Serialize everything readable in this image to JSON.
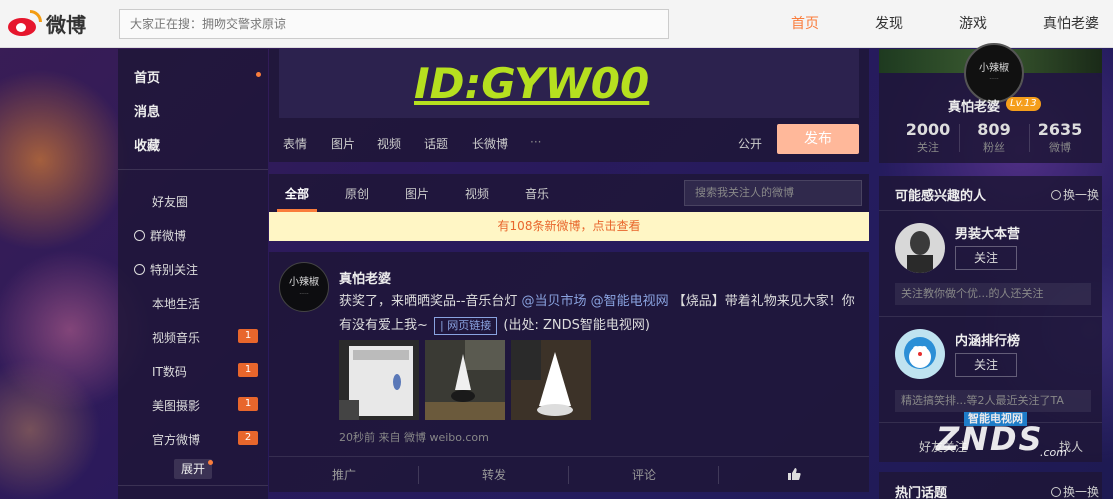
{
  "topbar": {
    "logo_text": "微博",
    "search_placeholder": "大家正在搜：拥吻交警求原谅",
    "nav": [
      "首页",
      "发现",
      "游戏",
      "真怕老婆"
    ]
  },
  "leftmenu": {
    "main": [
      "首页",
      "消息",
      "收藏"
    ],
    "groups": [
      {
        "label": "好友圈",
        "icon": "",
        "badge": ""
      },
      {
        "label": "群微博",
        "icon": "group-icon",
        "badge": ""
      },
      {
        "label": "特别关注",
        "icon": "star-icon",
        "badge": ""
      },
      {
        "label": "本地生活",
        "icon": "",
        "badge": ""
      },
      {
        "label": "视频音乐",
        "icon": "",
        "badge": "1"
      },
      {
        "label": "IT数码",
        "icon": "",
        "badge": "1"
      },
      {
        "label": "美图摄影",
        "icon": "",
        "badge": "1"
      },
      {
        "label": "官方微博",
        "icon": "",
        "badge": "2"
      }
    ],
    "expand": "展开"
  },
  "composer": {
    "content": "ID:GYW00",
    "tools": [
      "表情",
      "图片",
      "视频",
      "话题",
      "长微博",
      "···"
    ],
    "visibility": "公开",
    "publish": "发布"
  },
  "feed": {
    "tabs": [
      "全部",
      "原创",
      "图片",
      "视频",
      "音乐"
    ],
    "search_placeholder": "搜索我关注人的微博",
    "new_notice": "有108条新微博，点击查看"
  },
  "post": {
    "avatar_text": "小辣椒",
    "author": "真怕老婆",
    "text_1": "获奖了，来晒晒奖品--音乐台灯 ",
    "mention_1": "@当贝市场",
    "mention_2": " @智能电视网",
    "text_2": " 【烧品】带着礼物来见大家！你有没有爱上我~ ",
    "weblink": "网页链接",
    "text_3": " (出处: ZNDS智能电视网)",
    "meta": "20秒前 来自 微博 weibo.com",
    "actions": [
      "推广",
      "转发",
      "评论",
      ""
    ]
  },
  "profile": {
    "avatar_text": "小辣椒",
    "name": "真怕老婆",
    "level": "Lv.13",
    "stats": [
      {
        "num": "2000",
        "label": "关注"
      },
      {
        "num": "809",
        "label": "粉丝"
      },
      {
        "num": "2635",
        "label": "微博"
      }
    ]
  },
  "suggestions": {
    "title": "可能感兴趣的人",
    "swap": "换一换",
    "people": [
      {
        "name": "男装大本营",
        "follow": "关注",
        "note": "关注教你做个优...的人还关注"
      },
      {
        "name": "内涵排行榜",
        "follow": "关注",
        "note": "精选搞笑排...等2人最近关注了TA"
      }
    ],
    "partial_left": "好友关注",
    "partial_right": "找人"
  },
  "hot": {
    "title": "热门话题",
    "swap": "换一换"
  },
  "watermark": {
    "tag": "智能电视网",
    "brand": "ZNDS",
    "suffix": ".com"
  }
}
